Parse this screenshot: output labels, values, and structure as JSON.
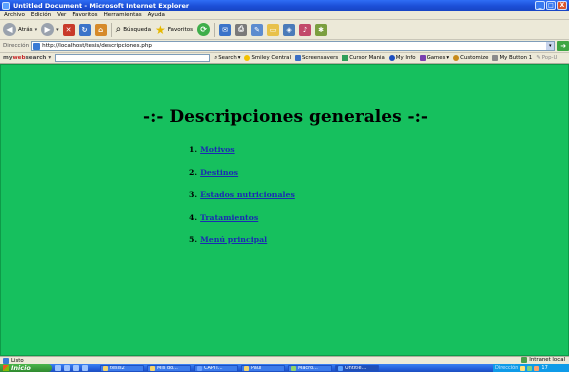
{
  "window": {
    "title": "Untitled Document - Microsoft Internet Explorer",
    "controls": [
      "_",
      "□",
      "X"
    ]
  },
  "menu": [
    "Archivo",
    "Edición",
    "Ver",
    "Favoritos",
    "Herramientas",
    "Ayuda"
  ],
  "toolbar": {
    "back_label": "Atrás",
    "search_label": "Búsqueda",
    "favorites_label": "Favoritos"
  },
  "address": {
    "label": "Dirección",
    "url": "http://localhost/tesis/descripciones.php"
  },
  "searchbar": {
    "brand_prefix": "my",
    "brand_highlight": "web",
    "brand_suffix": "search",
    "search_label": "Search",
    "smiley_label": "Smiley Central",
    "screensavers_label": "Screensavers",
    "cursor_label": "Cursor Mania",
    "myinfo_label": "My Info",
    "games_label": "Games",
    "customize_label": "Customize",
    "mybutton_label": "My Button 1",
    "more_label": "Pop-U"
  },
  "page": {
    "heading": "-:- Descripciones generales -:-",
    "nav_items": [
      {
        "number": "1.",
        "label": "Motivos"
      },
      {
        "number": "2.",
        "label": "Destinos"
      },
      {
        "number": "3.",
        "label": "Estados nutricionales"
      },
      {
        "number": "4.",
        "label": "Tratamientos"
      },
      {
        "number": "5.",
        "label": "Menú principal"
      }
    ],
    "background_color": "#16c05e",
    "link_color": "#1b2bb3"
  },
  "status": {
    "text": "Listo",
    "zone": "Intranet local"
  },
  "taskbar": {
    "start_label": "Inicio",
    "tasks": [
      "tesis2",
      "Mis do...",
      "CAPIT...",
      "Paul",
      "Macro...",
      "Untitle..."
    ],
    "tray_direction": "Dirección",
    "clock": "17"
  }
}
